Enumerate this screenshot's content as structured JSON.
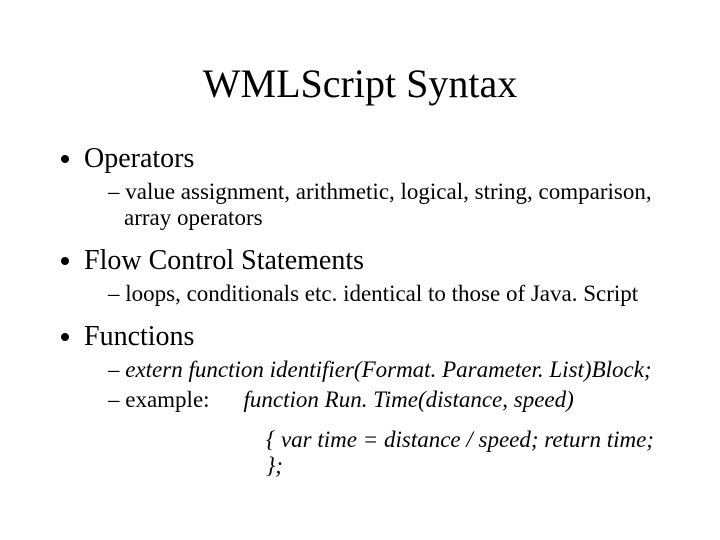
{
  "title": "WMLScript Syntax",
  "bullets": {
    "operators": {
      "label": "Operators",
      "sub1": "value assignment, arithmetic, logical, string, comparison, array operators"
    },
    "flow": {
      "label": "Flow Control Statements",
      "sub1": "loops, conditionals etc. identical to those of Java. Script"
    },
    "functions": {
      "label": "Functions",
      "sub1": "extern function identifier(Format. Parameter. List)Block;",
      "example_label": "example:",
      "example_code1": "function Run. Time(distance, speed)",
      "example_code2": "{ var time = distance / speed; return time; };"
    }
  }
}
